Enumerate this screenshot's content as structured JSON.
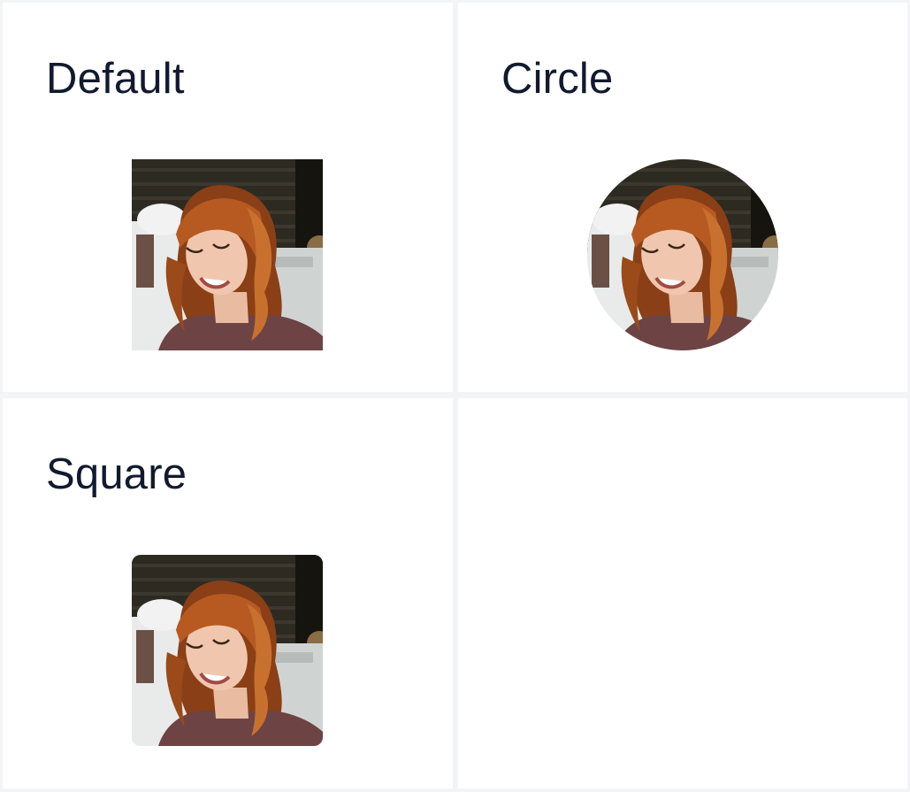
{
  "cards": [
    {
      "title": "Default",
      "avatar_shape": "default",
      "avatar_icon": "portrait-photo"
    },
    {
      "title": "Circle",
      "avatar_shape": "circle",
      "avatar_icon": "portrait-photo"
    },
    {
      "title": "Square",
      "avatar_shape": "square",
      "avatar_icon": "portrait-photo"
    }
  ],
  "colors": {
    "background": "#f3f4f6",
    "card": "#ffffff",
    "title_text": "#111a2e"
  }
}
